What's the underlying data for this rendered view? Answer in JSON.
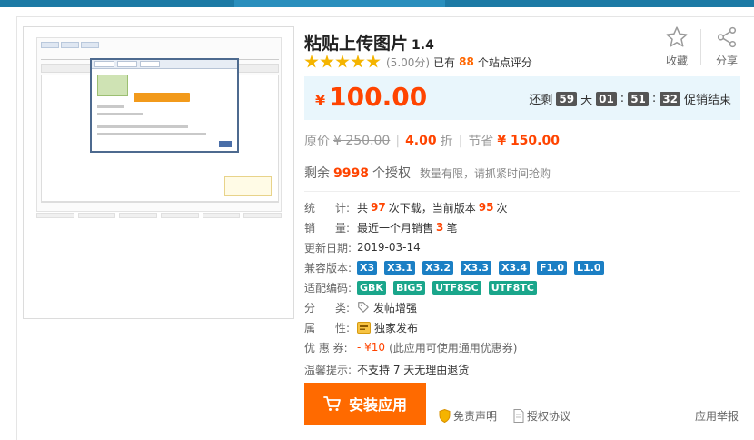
{
  "product": {
    "title": "粘贴上传图片",
    "version": "1.4",
    "rating": {
      "stars": 5,
      "score_text": "(5.00分)",
      "prefix": "已有",
      "count": "88",
      "suffix": "个站点评分"
    }
  },
  "actions": {
    "favorite_label": "收藏",
    "share_label": "分享"
  },
  "price": {
    "currency": "¥",
    "current": "100.00",
    "countdown": {
      "prefix": "还剩",
      "days": "59",
      "day_label": "天",
      "hours": "01",
      "minutes": "51",
      "seconds": "32",
      "suffix": "促销结束"
    }
  },
  "discount": {
    "orig_label": "原价",
    "orig_price": "¥ 250.00",
    "rate": "4.00",
    "rate_unit": "折",
    "save_label": "节省",
    "save_amount": "¥ 150.00"
  },
  "remain": {
    "prefix": "剩余",
    "count": "9998",
    "suffix": "个授权",
    "hint": "数量有限，请抓紧时间抢购"
  },
  "details": {
    "stats": {
      "label_a": "统",
      "label_b": "计:",
      "t1": "共",
      "downloads": "97",
      "t2": "次下载，当前版本",
      "current": "95",
      "t3": "次"
    },
    "sales": {
      "label_a": "销",
      "label_b": "量:",
      "t1": "最近一个月销售",
      "count": "3",
      "t2": "笔"
    },
    "updated": {
      "label": "更新日期:",
      "value": "2019-03-14"
    },
    "compat": {
      "label": "兼容版本:",
      "tags": [
        "X3",
        "X3.1",
        "X3.2",
        "X3.3",
        "X3.4",
        "F1.0",
        "L1.0"
      ]
    },
    "encoding": {
      "label": "适配编码:",
      "tags": [
        "GBK",
        "BIG5",
        "UTF8SC",
        "UTF8TC"
      ]
    },
    "category": {
      "label_a": "分",
      "label_b": "类:",
      "value": "发帖增强"
    },
    "attribute": {
      "label_a": "属",
      "label_b": "性:",
      "value": "独家发布"
    },
    "coupon": {
      "label": "优 惠 券:",
      "amount": "- ¥10",
      "note": "(此应用可使用通用优惠券)"
    },
    "tip": {
      "label": "温馨提示:",
      "value": "不支持 7 天无理由退货"
    }
  },
  "install": {
    "label": "安装应用"
  },
  "links": {
    "disclaimer": "免责声明",
    "license": "授权协议",
    "report": "应用举报"
  },
  "colors": {
    "accent": "#ff6a00",
    "price": "#ff4400",
    "price_bg": "#e9f6fc",
    "tag_blue": "#1b7fc4",
    "tag_teal": "#1aa68b",
    "star": "#f4b400"
  }
}
